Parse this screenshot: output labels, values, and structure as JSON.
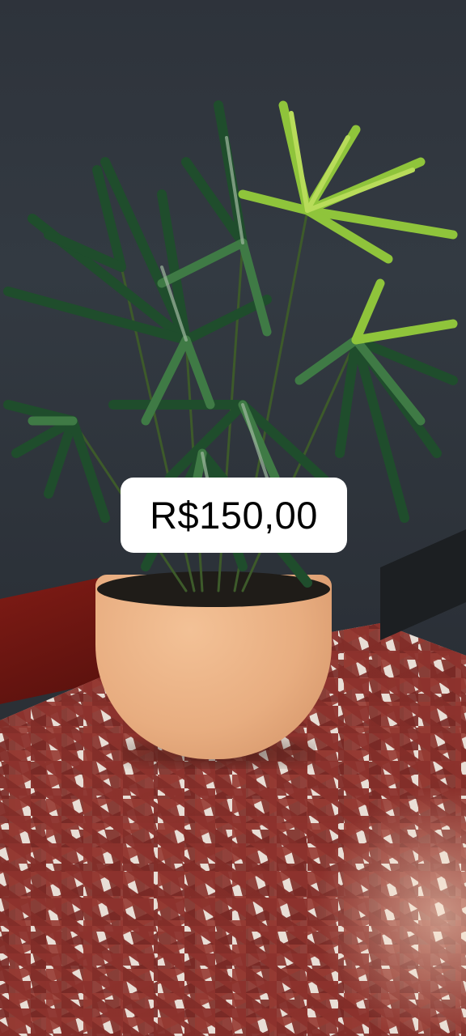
{
  "price_tag": {
    "text": "R$150,00",
    "background": "#ffffff",
    "text_color": "#000000"
  },
  "photo": {
    "subject": "potted-palm-plant",
    "pot_color": "#e8ad80",
    "floor_color": "#8a2f29",
    "wall_color": "#2e333b"
  }
}
